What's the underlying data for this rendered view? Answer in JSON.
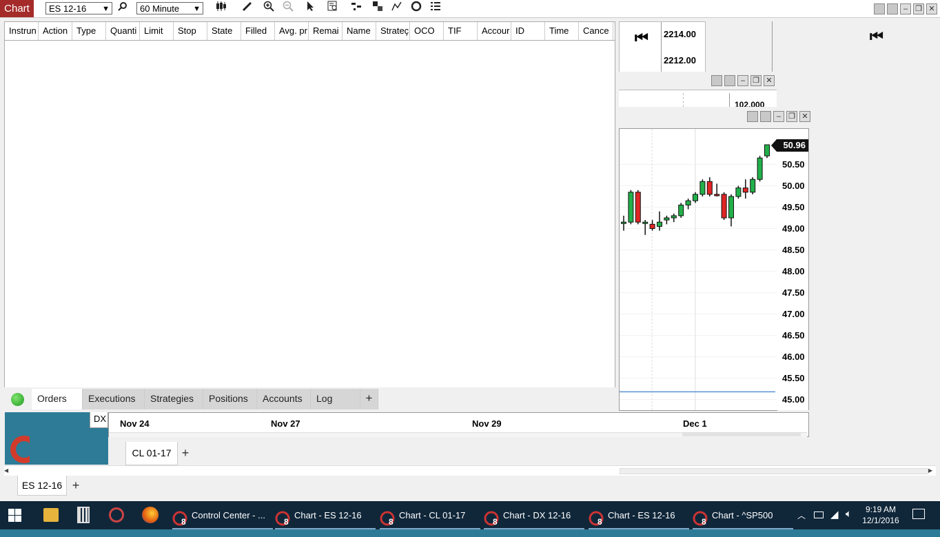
{
  "app": {
    "chart_tab": "Chart",
    "instrument": "ES 12-16",
    "interval": "60 Minute"
  },
  "toolbar_icons": [
    "search-icon",
    "candlestick-icon",
    "pencil-icon",
    "zoom-in-icon",
    "zoom-out-icon",
    "cursor-icon",
    "data-box-icon",
    "bars-icon",
    "strategy-icon",
    "indicator-icon",
    "reload-icon",
    "list-icon"
  ],
  "orders": {
    "columns": [
      "Instrun",
      "Action",
      "Type",
      "Quanti",
      "Limit",
      "Stop",
      "State",
      "Filled",
      "Avg. pr",
      "Remai",
      "Name",
      "Strateç",
      "OCO",
      "TIF",
      "Accour",
      "ID",
      "Time",
      "Cance"
    ],
    "tabs": [
      "Orders",
      "Executions",
      "Strategies",
      "Positions",
      "Accounts",
      "Log"
    ],
    "add_tab": "+"
  },
  "chart_behind": {
    "prices": [
      "2214.00",
      "2212.00",
      "102.000"
    ],
    "dx_label": "DX"
  },
  "chart": {
    "current_price": "50.96",
    "y_ticks": [
      "50.50",
      "50.00",
      "49.50",
      "49.00",
      "48.50",
      "48.00",
      "47.50",
      "47.00",
      "46.50",
      "46.00",
      "45.50",
      "45.00"
    ],
    "x_ticks": [
      "Nov 24",
      "Nov 27",
      "Nov 29",
      "Dec 1"
    ],
    "tab": "CL 01-17",
    "add_tab": "+"
  },
  "chart_data": {
    "type": "candlestick",
    "y_ticks": [
      50.5,
      50.0,
      49.5,
      49.0,
      48.5,
      48.0,
      47.5,
      47.0,
      46.5,
      46.0,
      45.5,
      45.0
    ],
    "last": 50.96,
    "candles": [
      {
        "o": 49.15,
        "h": 49.3,
        "l": 48.95,
        "c": 49.15,
        "up": true
      },
      {
        "o": 49.15,
        "h": 49.9,
        "l": 49.1,
        "c": 49.85,
        "up": true
      },
      {
        "o": 49.85,
        "h": 49.9,
        "l": 49.1,
        "c": 49.15,
        "up": false
      },
      {
        "o": 49.15,
        "h": 49.2,
        "l": 48.85,
        "c": 49.15,
        "up": true
      },
      {
        "o": 49.1,
        "h": 49.2,
        "l": 48.95,
        "c": 49.0,
        "up": false
      },
      {
        "o": 49.05,
        "h": 49.4,
        "l": 48.95,
        "c": 49.15,
        "up": true
      },
      {
        "o": 49.2,
        "h": 49.3,
        "l": 49.1,
        "c": 49.25,
        "up": true
      },
      {
        "o": 49.25,
        "h": 49.35,
        "l": 49.15,
        "c": 49.3,
        "up": true
      },
      {
        "o": 49.3,
        "h": 49.6,
        "l": 49.25,
        "c": 49.55,
        "up": true
      },
      {
        "o": 49.55,
        "h": 49.7,
        "l": 49.45,
        "c": 49.65,
        "up": true
      },
      {
        "o": 49.65,
        "h": 49.85,
        "l": 49.6,
        "c": 49.8,
        "up": true
      },
      {
        "o": 49.8,
        "h": 50.15,
        "l": 49.75,
        "c": 50.1,
        "up": true
      },
      {
        "o": 50.1,
        "h": 50.2,
        "l": 49.75,
        "c": 49.8,
        "up": false
      },
      {
        "o": 49.8,
        "h": 50.05,
        "l": 49.75,
        "c": 49.8,
        "up": false
      },
      {
        "o": 49.8,
        "h": 49.85,
        "l": 49.2,
        "c": 49.25,
        "up": false
      },
      {
        "o": 49.25,
        "h": 49.8,
        "l": 49.05,
        "c": 49.75,
        "up": true
      },
      {
        "o": 49.75,
        "h": 50.0,
        "l": 49.7,
        "c": 49.95,
        "up": true
      },
      {
        "o": 49.95,
        "h": 50.15,
        "l": 49.7,
        "c": 49.85,
        "up": false
      },
      {
        "o": 49.85,
        "h": 50.2,
        "l": 49.8,
        "c": 50.15,
        "up": true
      },
      {
        "o": 50.15,
        "h": 50.7,
        "l": 50.1,
        "c": 50.65,
        "up": true
      },
      {
        "o": 50.7,
        "h": 50.96,
        "l": 50.65,
        "c": 50.96,
        "up": true
      }
    ],
    "hline": 45.18
  },
  "bottom": {
    "tab": "ES 12-16",
    "add_tab": "+"
  },
  "taskbar": {
    "items": [
      "Control Center - ...",
      "Chart - ES 12-16",
      "Chart - CL 01-17",
      "Chart - DX 12-16",
      "Chart - ES 12-16",
      "Chart - ^SP500"
    ],
    "time": "9:19 AM",
    "date": "12/1/2016"
  },
  "colors": {
    "up": "#22b04a",
    "down": "#e02525",
    "accent": "#a52b2b",
    "desktop": "#2e7b97",
    "taskbar": "#10273a"
  }
}
